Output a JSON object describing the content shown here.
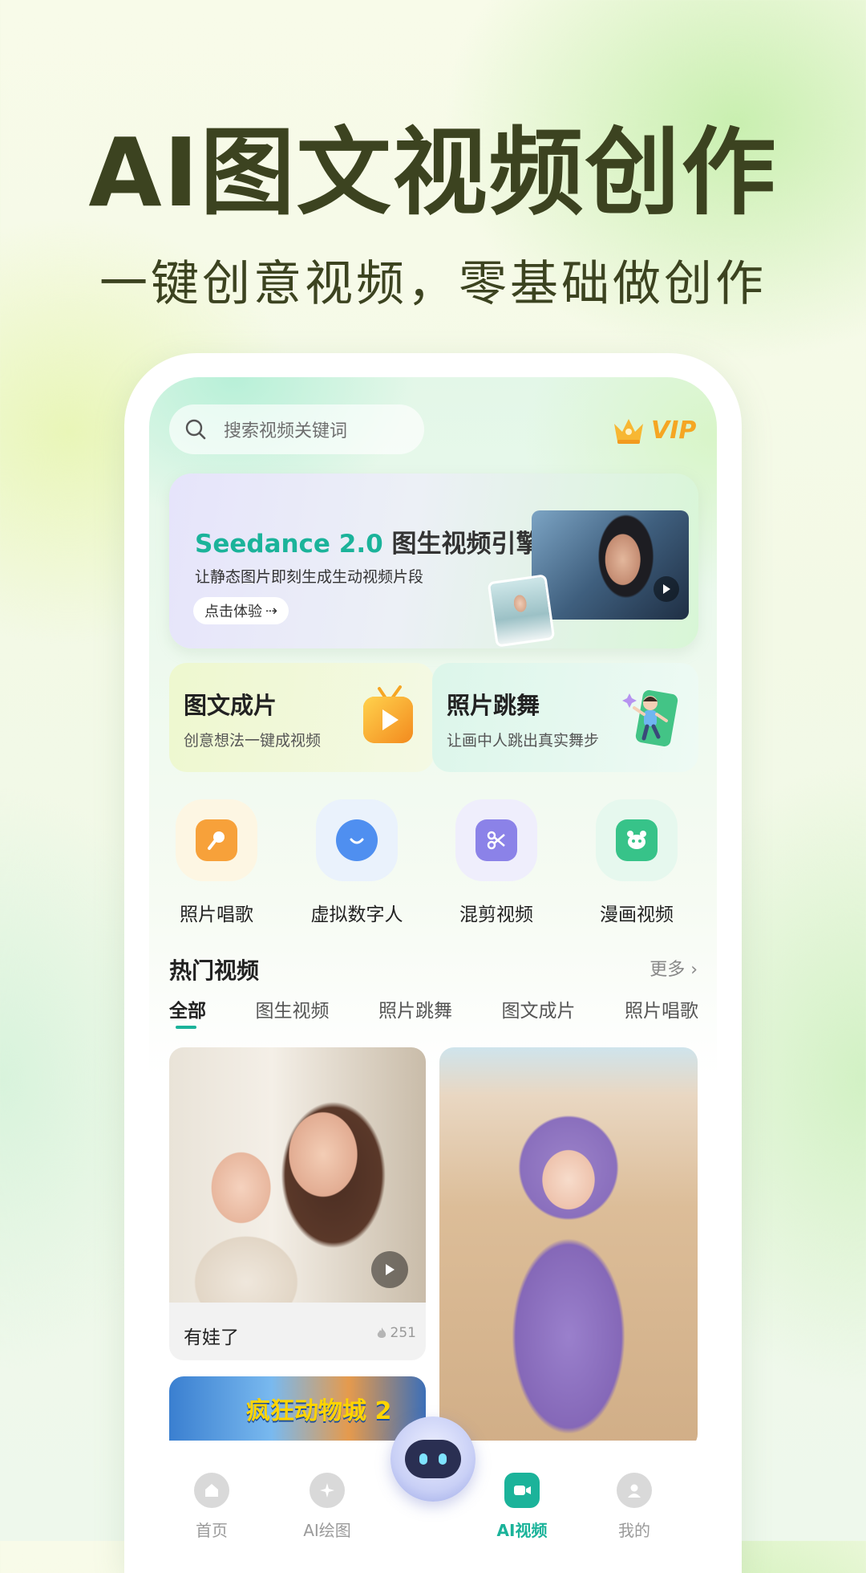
{
  "hero": {
    "title": "AI图文视频创作",
    "subtitle": "一键创意视频，零基础做创作"
  },
  "search": {
    "placeholder": "搜索视频关键词",
    "icon": "search-icon"
  },
  "vip": {
    "label": "VIP",
    "icon": "crown-icon"
  },
  "banner": {
    "brand": "Seedance 2.0",
    "title": "图生视频引擎",
    "desc": "让静态图片即刻生成生动视频片段",
    "button": "点击体验",
    "button_arrow": "⇢"
  },
  "features": [
    {
      "title": "图文成片",
      "desc": "创意想法一键成视频",
      "icon": "tv-play-icon"
    },
    {
      "title": "照片跳舞",
      "desc": "让画中人跳出真实舞步",
      "icon": "dancing-phone-icon"
    }
  ],
  "quick": [
    {
      "label": "照片唱歌",
      "icon": "microphone-icon",
      "color": "#f7a13a",
      "bg": "#fdf6e3"
    },
    {
      "label": "虚拟数字人",
      "icon": "chat-bubble-icon",
      "color": "#4f8ff0",
      "bg": "#eaf2fc"
    },
    {
      "label": "混剪视频",
      "icon": "scissors-icon",
      "color": "#8b82e8",
      "bg": "#efeefc"
    },
    {
      "label": "漫画视频",
      "icon": "panda-icon",
      "color": "#37c389",
      "bg": "#e6f8ee"
    }
  ],
  "hot": {
    "title": "热门视频",
    "more": "更多 ›",
    "tabs": [
      "全部",
      "图生视频",
      "照片跳舞",
      "图文成片",
      "照片唱歌"
    ],
    "cards": [
      {
        "caption": "有娃了",
        "likes": "251"
      },
      {
        "caption": ""
      },
      {
        "title_art": "疯狂动物城 2"
      }
    ]
  },
  "nav": [
    {
      "label": "首页",
      "icon": "home-icon"
    },
    {
      "label": "AI绘图",
      "icon": "sparkle-icon"
    },
    {
      "label": "AI视频",
      "icon": "video-camera-icon",
      "active": true
    },
    {
      "label": "我的",
      "icon": "user-icon"
    }
  ],
  "colors": {
    "accent": "#1bb39a",
    "vip": "#f5a623",
    "heading": "#3c4320"
  }
}
